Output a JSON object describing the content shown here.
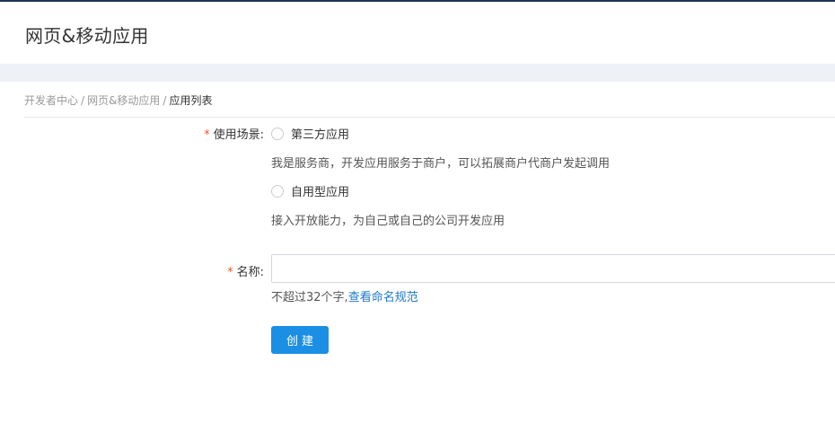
{
  "header": {
    "title": "网页&移动应用"
  },
  "breadcrumb": {
    "items": [
      "开发者中心",
      "网页&移动应用"
    ],
    "separator": "/",
    "current": "应用列表"
  },
  "form": {
    "scenario": {
      "required_mark": "*",
      "label": "使用场景",
      "colon": ":",
      "options": [
        {
          "label": "第三方应用",
          "description": "我是服务商，开发应用服务于商户，可以拓展商户代商户发起调用",
          "checked": false
        },
        {
          "label": "自用型应用",
          "description": "接入开放能力，为自己或自己的公司开发应用",
          "checked": false
        }
      ]
    },
    "name": {
      "required_mark": "*",
      "label": "名称",
      "colon": ":",
      "value": "",
      "hint_text": "不超过32个字,",
      "hint_link": "查看命名规范"
    },
    "submit_label": "创建"
  },
  "colors": {
    "primary": "#1a8fe3",
    "required": "#e8562e",
    "link": "#1e78c8",
    "band": "#eef1f6"
  }
}
